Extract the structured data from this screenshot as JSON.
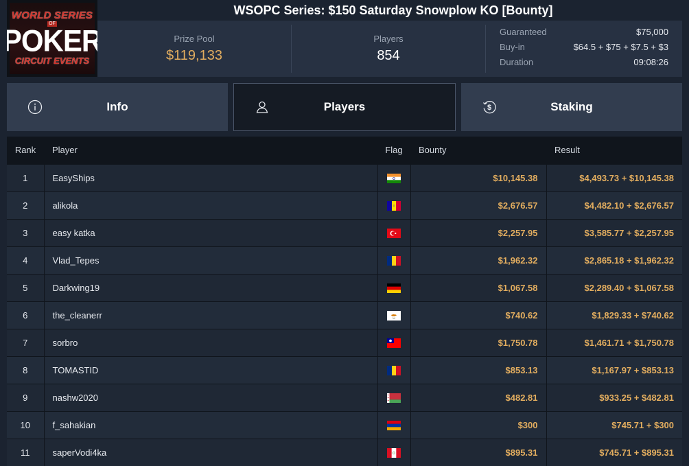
{
  "logo": {
    "top": "WORLD SERIES",
    "of": "OF",
    "main": "POKER",
    "bottom": "CIRCUIT EVENTS"
  },
  "title": "WSOPC Series: $150 Saturday Snowplow KO [Bounty]",
  "stats": {
    "prize_pool_label": "Prize Pool",
    "prize_pool_value": "$119,133",
    "players_label": "Players",
    "players_value": "854",
    "guaranteed_label": "Guaranteed",
    "guaranteed_value": "$75,000",
    "buyin_label": "Buy-in",
    "buyin_value": "$64.5 + $75 + $7.5 + $3",
    "duration_label": "Duration",
    "duration_value": "09:08:26"
  },
  "tabs": [
    {
      "label": "Info",
      "icon": "info-icon",
      "active": false
    },
    {
      "label": "Players",
      "icon": "user-icon",
      "active": true
    },
    {
      "label": "Staking",
      "icon": "dollar-icon",
      "active": false
    }
  ],
  "table": {
    "headers": {
      "rank": "Rank",
      "player": "Player",
      "flag": "Flag",
      "bounty": "Bounty",
      "result": "Result"
    },
    "rows": [
      {
        "rank": "1",
        "player": "EasyShips",
        "flag": "india",
        "bounty": "$10,145.38",
        "result": "$4,493.73 + $10,145.38"
      },
      {
        "rank": "2",
        "player": "alikola",
        "flag": "andorra",
        "bounty": "$2,676.57",
        "result": "$4,482.10 + $2,676.57"
      },
      {
        "rank": "3",
        "player": "easy katka",
        "flag": "turkey",
        "bounty": "$2,257.95",
        "result": "$3,585.77 + $2,257.95"
      },
      {
        "rank": "4",
        "player": "Vlad_Tepes",
        "flag": "romania",
        "bounty": "$1,962.32",
        "result": "$2,865.18 + $1,962.32"
      },
      {
        "rank": "5",
        "player": "Darkwing19",
        "flag": "germany",
        "bounty": "$1,067.58",
        "result": "$2,289.40 + $1,067.58"
      },
      {
        "rank": "6",
        "player": "the_cleanerr",
        "flag": "cyprus",
        "bounty": "$740.62",
        "result": "$1,829.33 + $740.62"
      },
      {
        "rank": "7",
        "player": "sorbro",
        "flag": "taiwan",
        "bounty": "$1,750.78",
        "result": "$1,461.71 + $1,750.78"
      },
      {
        "rank": "8",
        "player": "TOMASTID",
        "flag": "romania",
        "bounty": "$853.13",
        "result": "$1,167.97 + $853.13"
      },
      {
        "rank": "9",
        "player": "nashw2020",
        "flag": "belarus",
        "bounty": "$482.81",
        "result": "$933.25 + $482.81"
      },
      {
        "rank": "10",
        "player": "f_sahakian",
        "flag": "armenia",
        "bounty": "$300",
        "result": "$745.71 + $300"
      },
      {
        "rank": "11",
        "player": "saperVodi4ka",
        "flag": "peru",
        "bounty": "$895.31",
        "result": "$745.71 + $895.31"
      }
    ]
  },
  "colors": {
    "gold": "#e2ad5f",
    "background": "#1b2330",
    "panel": "#273142",
    "tab": "#323d4f",
    "tab_active": "#151b24"
  }
}
